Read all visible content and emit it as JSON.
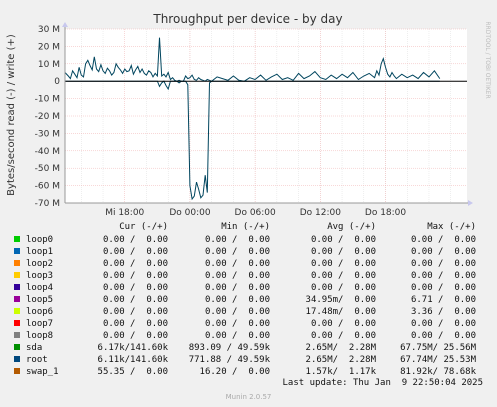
{
  "chart_data": {
    "type": "line",
    "title": "Throughput per device - by day",
    "ylabel": "Bytes/second read (-) / write (+)",
    "side_label": "RRDTOOL / TOBI OETIKER",
    "ylim": [
      -70000000,
      30000000
    ],
    "y_ticks": [
      30000000,
      20000000,
      10000000,
      0,
      -10000000,
      -20000000,
      -30000000,
      -40000000,
      -50000000,
      -60000000,
      -70000000
    ],
    "y_tick_labels": [
      "30 M",
      "20 M",
      "10 M",
      "0",
      "-10 M",
      "-20 M",
      "-30 M",
      "-40 M",
      "-50 M",
      "-60 M",
      "-70 M"
    ],
    "x_range_hours": [
      -34.5,
      2.5
    ],
    "x_ticks": [
      -29,
      -23,
      -17,
      -11,
      -5
    ],
    "x_tick_labels": [
      "Mi 18:00",
      "Do 00:00",
      "Do 06:00",
      "Do 12:00",
      "Do 18:00"
    ],
    "series_color": "#00455e",
    "series": [
      {
        "name": "root",
        "x": [
          -34.5,
          -34.2,
          -34.0,
          -33.8,
          -33.6,
          -33.4,
          -33.2,
          -33.0,
          -32.8,
          -32.6,
          -32.4,
          -32.2,
          -32.0,
          -31.8,
          -31.6,
          -31.4,
          -31.2,
          -31.0,
          -30.8,
          -30.6,
          -30.4,
          -30.2,
          -30.0,
          -29.8,
          -29.6,
          -29.4,
          -29.2,
          -29.0,
          -28.8,
          -28.6,
          -28.4,
          -28.2,
          -28.0,
          -27.8,
          -27.6,
          -27.4,
          -27.2,
          -27.0,
          -26.8,
          -26.6,
          -26.4,
          -26.2,
          -26.0,
          -25.8,
          -25.6,
          -25.4,
          -25.2,
          -25.0,
          -24.8,
          -24.6,
          -24.4,
          -24.2,
          -24.0,
          -23.8,
          -23.6,
          -23.4,
          -23.2,
          -23.0,
          -22.8,
          -22.6,
          -22.4,
          -22.2,
          -22.0,
          -21.8,
          -21.6,
          -21.4,
          -21.2,
          -21.0,
          -20.5,
          -20.0,
          -19.5,
          -19.0,
          -18.5,
          -18.0,
          -17.5,
          -17.0,
          -16.5,
          -16.0,
          -15.5,
          -15.0,
          -14.5,
          -14.0,
          -13.5,
          -13.0,
          -12.5,
          -12.0,
          -11.5,
          -11.0,
          -10.5,
          -10.0,
          -9.5,
          -9.0,
          -8.5,
          -8.0,
          -7.5,
          -7.0,
          -6.5,
          -6.0,
          -5.8,
          -5.6,
          -5.4,
          -5.2,
          -5.0,
          -4.8,
          -4.6,
          -4.4,
          -4.2,
          -4.0,
          -3.5,
          -3.0,
          -2.5,
          -2.0,
          -1.5,
          -1.0,
          -0.5,
          0.0
        ],
        "write": [
          5.0,
          3.0,
          1.5,
          6.0,
          4.0,
          2.0,
          8.0,
          3.5,
          2.5,
          10.0,
          12.0,
          9.0,
          6.5,
          14.0,
          7.0,
          5.5,
          9.5,
          6.0,
          4.5,
          7.5,
          6.0,
          3.5,
          5.0,
          10.0,
          8.0,
          6.5,
          4.5,
          7.0,
          5.5,
          6.0,
          9.0,
          4.0,
          6.5,
          8.5,
          5.0,
          7.0,
          4.5,
          3.5,
          6.0,
          5.0,
          2.5,
          4.5,
          3.0,
          25.0,
          3.0,
          4.0,
          2.5,
          5.0,
          1.0,
          2.0,
          0.5,
          0.0,
          0.5,
          0.0,
          0.0,
          3.0,
          1.5,
          2.0,
          3.5,
          1.0,
          0.5,
          2.0,
          1.0,
          0.5,
          0.0,
          1.0,
          0.5,
          0.0,
          2.5,
          1.5,
          0.5,
          3.0,
          0.5,
          0.0,
          2.0,
          1.0,
          3.5,
          0.5,
          2.5,
          4.0,
          1.0,
          2.0,
          0.5,
          4.5,
          1.5,
          3.0,
          5.5,
          2.0,
          1.0,
          3.5,
          1.5,
          4.0,
          2.0,
          5.0,
          1.0,
          3.0,
          4.5,
          2.0,
          6.0,
          3.5,
          10.0,
          13.0,
          8.0,
          4.0,
          2.5,
          5.0,
          3.0,
          1.5,
          4.0,
          2.0,
          3.5,
          1.5,
          5.0,
          2.5,
          6.0,
          1.5
        ],
        "read": [
          0.0,
          0.0,
          0.0,
          0.0,
          0.0,
          0.0,
          0.0,
          0.0,
          0.0,
          0.0,
          0.0,
          0.0,
          0.0,
          0.0,
          0.0,
          0.0,
          0.0,
          0.0,
          0.0,
          0.0,
          0.0,
          0.0,
          0.0,
          0.0,
          0.0,
          0.0,
          0.0,
          0.0,
          0.0,
          0.0,
          0.0,
          0.0,
          0.0,
          0.0,
          0.0,
          0.0,
          0.0,
          0.0,
          0.0,
          0.0,
          0.0,
          0.0,
          0.0,
          -3.0,
          -1.0,
          0.0,
          -2.5,
          -4.5,
          0.0,
          0.0,
          0.0,
          0.0,
          -1.0,
          0.0,
          0.0,
          0.0,
          -2.0,
          -60.0,
          -67.7,
          -66.0,
          -58.0,
          -62.0,
          -67.0,
          -65.5,
          -54.0,
          -64.0,
          -1.0,
          0.0,
          0.0,
          0.0,
          0.0,
          0.0,
          0.0,
          0.0,
          0.0,
          0.0,
          0.0,
          0.0,
          0.0,
          0.0,
          0.0,
          0.0,
          0.0,
          0.0,
          0.0,
          0.0,
          0.0,
          0.0,
          0.0,
          0.0,
          0.0,
          0.0,
          0.0,
          0.0,
          0.0,
          0.0,
          0.0,
          0.0,
          0.0,
          0.0,
          0.0,
          0.0,
          0.0,
          0.0,
          0.0,
          0.0,
          0.0,
          0.0,
          0.0,
          0.0,
          0.0,
          0.0,
          0.0,
          0.0,
          0.0,
          0.0
        ]
      }
    ],
    "grid": true,
    "zero_line_color": "#000000"
  },
  "legend": {
    "headers": {
      "cur": "Cur (-/+)",
      "min": "Min (-/+)",
      "avg": "Avg (-/+)",
      "max": "Max (-/+)"
    },
    "rows": [
      {
        "name": "loop0",
        "color": "#00cc00",
        "cur": "0.00 /  0.00",
        "min": "0.00 /  0.00",
        "avg": "0.00 /  0.00",
        "max": "0.00 /  0.00"
      },
      {
        "name": "loop1",
        "color": "#0066b3",
        "cur": "0.00 /  0.00",
        "min": "0.00 /  0.00",
        "avg": "0.00 /  0.00",
        "max": "0.00 /  0.00"
      },
      {
        "name": "loop2",
        "color": "#ff8000",
        "cur": "0.00 /  0.00",
        "min": "0.00 /  0.00",
        "avg": "0.00 /  0.00",
        "max": "0.00 /  0.00"
      },
      {
        "name": "loop3",
        "color": "#ffcc00",
        "cur": "0.00 /  0.00",
        "min": "0.00 /  0.00",
        "avg": "0.00 /  0.00",
        "max": "0.00 /  0.00"
      },
      {
        "name": "loop4",
        "color": "#330099",
        "cur": "0.00 /  0.00",
        "min": "0.00 /  0.00",
        "avg": "0.00 /  0.00",
        "max": "0.00 /  0.00"
      },
      {
        "name": "loop5",
        "color": "#990099",
        "cur": "0.00 /  0.00",
        "min": "0.00 /  0.00",
        "avg": "34.95m/  0.00",
        "max": "6.71 /  0.00"
      },
      {
        "name": "loop6",
        "color": "#ccff00",
        "cur": "0.00 /  0.00",
        "min": "0.00 /  0.00",
        "avg": "17.48m/  0.00",
        "max": "3.36 /  0.00"
      },
      {
        "name": "loop7",
        "color": "#ff0000",
        "cur": "0.00 /  0.00",
        "min": "0.00 /  0.00",
        "avg": "0.00 /  0.00",
        "max": "0.00 /  0.00"
      },
      {
        "name": "loop8",
        "color": "#808080",
        "cur": "0.00 /  0.00",
        "min": "0.00 /  0.00",
        "avg": "0.00 /  0.00",
        "max": "0.00 /  0.00"
      },
      {
        "name": "sda",
        "color": "#008f00",
        "cur": "6.17k/141.60k",
        "min": "893.09 / 49.59k",
        "avg": "2.65M/  2.28M",
        "max": "67.75M/ 25.56M"
      },
      {
        "name": "root",
        "color": "#00487d",
        "cur": "6.11k/141.60k",
        "min": "771.88 / 49.59k",
        "avg": "2.65M/  2.28M",
        "max": "67.74M/ 25.53M"
      },
      {
        "name": "swap_1",
        "color": "#b35a00",
        "cur": "55.35 /  0.00",
        "min": "16.20 /  0.00",
        "avg": "1.57k/  1.17k",
        "max": "81.92k/ 78.68k"
      }
    ]
  },
  "last_update": "Last update: Thu Jan  9 22:50:04 2025",
  "footer": "Munin 2.0.57"
}
